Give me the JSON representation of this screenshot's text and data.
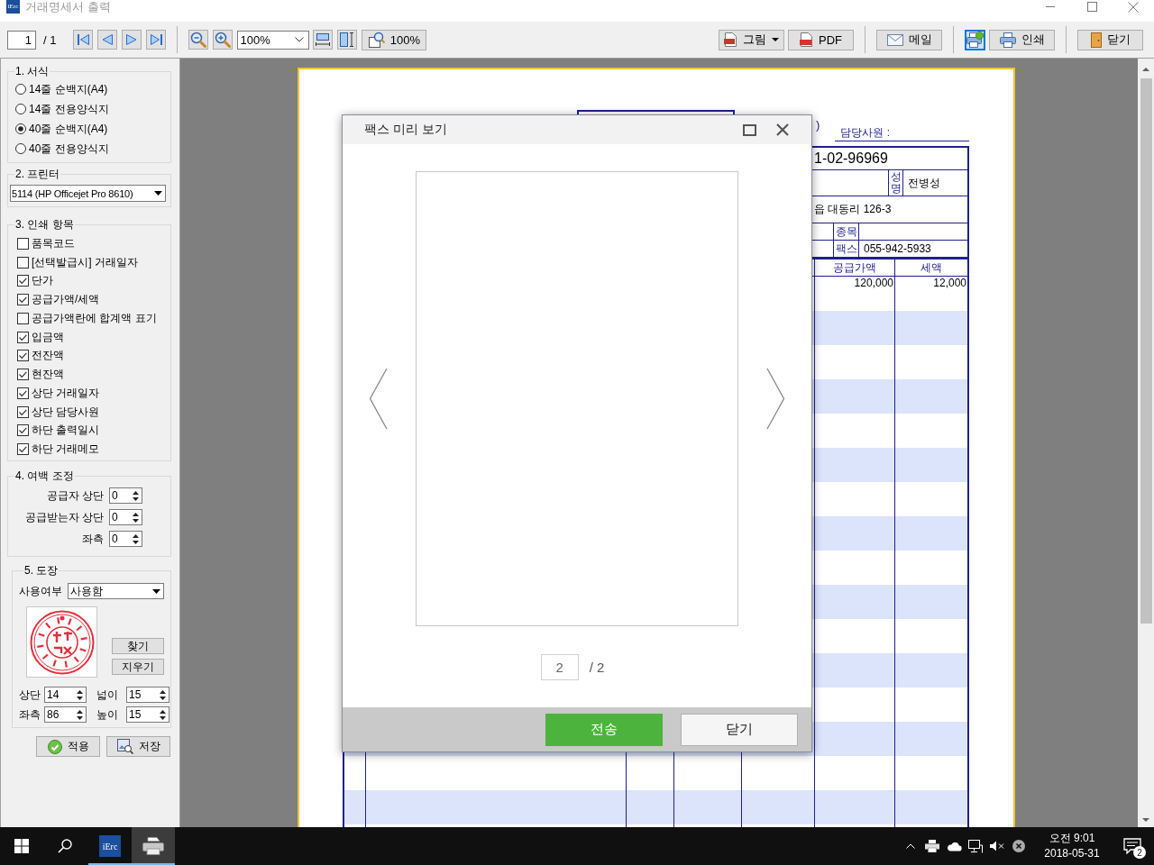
{
  "window": {
    "icon_text": "iErc",
    "title": "거래명세서 출력"
  },
  "toolbar": {
    "page": {
      "value": "1",
      "total": "/ 1"
    },
    "zoom": {
      "value": "100%"
    },
    "zoom_preset": {
      "label": "100%"
    },
    "groups": [
      {
        "buttons": [
          {
            "kind": "image",
            "label": "그림",
            "has_menu": true,
            "selected": false
          },
          {
            "kind": "pdf",
            "label": "PDF",
            "selected": false
          }
        ]
      },
      {
        "buttons": [
          {
            "kind": "mail",
            "label": "메일",
            "selected": false
          }
        ]
      },
      {
        "buttons": [
          {
            "kind": "fax",
            "selected": true
          },
          {
            "kind": "print",
            "label": "인쇄",
            "selected": false
          }
        ]
      },
      {
        "buttons": [
          {
            "kind": "close",
            "label": "닫기",
            "selected": false
          }
        ]
      }
    ]
  },
  "panel": {
    "format": {
      "legend": "1. 서식",
      "options": [
        {
          "label": "14줄 순백지(A4)",
          "selected": false
        },
        {
          "label": "14줄 전용양식지",
          "selected": false
        },
        {
          "label": "40줄 순백지(A4)",
          "selected": true
        },
        {
          "label": "40줄 전용양식지",
          "selected": false
        }
      ]
    },
    "printer": {
      "legend": "2. 프린터",
      "value": "5114 (HP Officejet Pro 8610)"
    },
    "print_items": {
      "legend": "3. 인쇄 항목",
      "items": [
        {
          "label": "품목코드",
          "checked": false
        },
        {
          "label": "[선택발급시] 거래일자",
          "checked": false
        },
        {
          "label": "단가",
          "checked": true
        },
        {
          "label": "공급가액/세액",
          "checked": true
        },
        {
          "label": "공급가액란에 합계액 표기",
          "checked": false
        },
        {
          "label": "입금액",
          "checked": true
        },
        {
          "label": "전잔액",
          "checked": true
        },
        {
          "label": "현잔액",
          "checked": true
        },
        {
          "label": "상단 거래일자",
          "checked": true
        },
        {
          "label": "상단 담당사원",
          "checked": true
        },
        {
          "label": "하단 출력일시",
          "checked": true
        },
        {
          "label": "하단 거래메모",
          "checked": true
        }
      ]
    },
    "margins": {
      "legend": "4. 여백 조정",
      "fields": [
        {
          "label": "공급자 상단",
          "value": "0"
        },
        {
          "label": "공급받는자 상단",
          "value": "0"
        },
        {
          "label": "좌측",
          "value": "0"
        }
      ]
    },
    "stamp": {
      "legend": "5. 도장",
      "usage": {
        "label": "사용여부",
        "value": "사용함"
      },
      "buttons": [
        {
          "label": "찾기"
        },
        {
          "label": "지우기"
        }
      ],
      "fields": [
        {
          "label": "상단",
          "value": "14"
        },
        {
          "label": "넓이",
          "value": "15"
        },
        {
          "label": "좌측",
          "value": "86"
        },
        {
          "label": "높이",
          "value": "15"
        }
      ]
    },
    "actions": [
      {
        "kind": "apply",
        "label": "적용"
      },
      {
        "kind": "save",
        "label": "저장"
      }
    ]
  },
  "document": {
    "partial_text": ")",
    "staff_label": "담당사원 :",
    "supplier": {
      "registration_number": "1-02-96969",
      "name_label": "성명",
      "name": "전병성",
      "address": "읍 대동리 126-3",
      "category_label": "종목",
      "fax_label": "팩스",
      "fax": "055-942-5933"
    },
    "table": {
      "columns": [
        "공급가액",
        "세액"
      ],
      "rows": [
        {
          "cells": [
            "120,000",
            "12,000"
          ]
        }
      ]
    }
  },
  "dialog": {
    "title": "팩스 미리 보기",
    "page": {
      "value": "2",
      "total": "/ 2"
    },
    "buttons": [
      {
        "kind": "primary",
        "label": "전송"
      },
      {
        "kind": "secondary",
        "label": "닫기"
      }
    ]
  },
  "taskbar": {
    "apps": [
      {
        "kind": "logo",
        "label": "iErc",
        "selected": false
      },
      {
        "kind": "printer",
        "selected": true
      }
    ],
    "clock": {
      "time": "오전 9:01",
      "date": "2018-05-31"
    },
    "notification_count": "2"
  }
}
